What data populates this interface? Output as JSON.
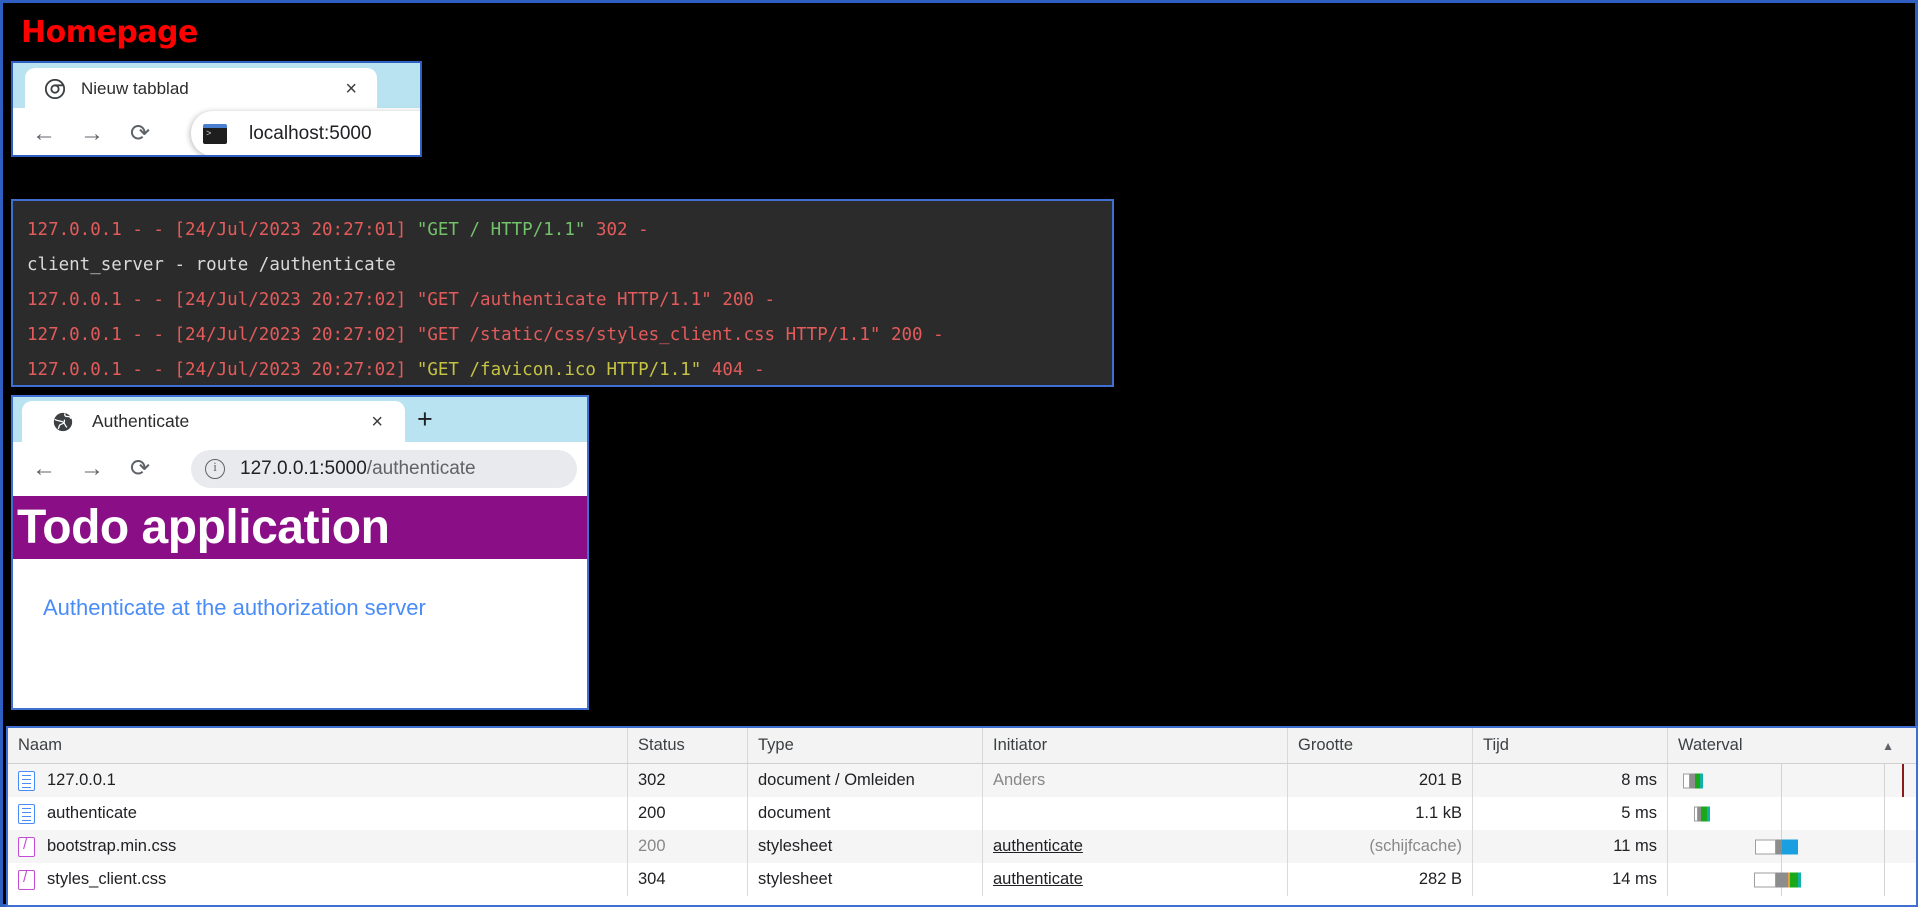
{
  "page": {
    "title": "Homepage",
    "background": "#000000",
    "border_color": "#2f5fc0",
    "title_color": "#ff0000"
  },
  "chrome_top": {
    "tab": {
      "title": "Nieuw tabblad",
      "close": "×",
      "favicon": "chrome-logo-icon"
    },
    "nav": {
      "back": "←",
      "forward": "→",
      "reload": "⟳"
    },
    "omnibox": {
      "url": "localhost:5000",
      "icon": "terminal-icon"
    }
  },
  "terminal": {
    "background": "#2b2b2b",
    "lines": [
      {
        "parts": [
          {
            "text": "127.0.0.1 - - [24/Jul/2023 20:27:01] ",
            "color": "red"
          },
          {
            "text": "\"GET / HTTP/1.1\" ",
            "color": "green"
          },
          {
            "text": "302 -",
            "color": "red"
          }
        ]
      },
      {
        "parts": [
          {
            "text": "client_server - route /authenticate",
            "color": "white"
          }
        ]
      },
      {
        "parts": [
          {
            "text": "127.0.0.1 - - [24/Jul/2023 20:27:02] \"GET /authenticate HTTP/1.1\" 200 -",
            "color": "red"
          }
        ]
      },
      {
        "parts": [
          {
            "text": "127.0.0.1 - - [24/Jul/2023 20:27:02] \"GET /static/css/styles_client.css HTTP/1.1\" 200 -",
            "color": "red"
          }
        ]
      },
      {
        "parts": [
          {
            "text": "127.0.0.1 - - [24/Jul/2023 20:27:02] ",
            "color": "red"
          },
          {
            "text": "\"GET /favicon.ico HTTP/1.1\" ",
            "color": "olive"
          },
          {
            "text": "404 -",
            "color": "red"
          }
        ]
      }
    ]
  },
  "chrome_auth": {
    "tab": {
      "title": "Authenticate",
      "close": "×",
      "favicon": "globe-icon"
    },
    "new_tab_button": "+",
    "nav": {
      "back": "←",
      "forward": "→",
      "reload": "⟳"
    },
    "omnibox": {
      "icon": "info-circle-icon",
      "host": "127.0.0.1:5000",
      "path": "/authenticate"
    },
    "banner": {
      "text": "Todo application",
      "color": "#8a0f87"
    },
    "link": {
      "text": "Authenticate at the authorization server",
      "color": "#4a8cf7"
    }
  },
  "devtools": {
    "columns": [
      "Naam",
      "Status",
      "Type",
      "Initiator",
      "Grootte",
      "Tijd",
      "Waterval"
    ],
    "sort_indicator": "▲",
    "rows": [
      {
        "icon": "document-icon",
        "name": "127.0.0.1",
        "status": "302",
        "type": "document / Omleiden",
        "initiator": "Anders",
        "initiator_link": false,
        "initiator_dim": true,
        "size": "201 B",
        "size_dim": false,
        "time": "8 ms",
        "status_dim": false
      },
      {
        "icon": "document-icon",
        "name": "authenticate",
        "status": "200",
        "type": "document",
        "initiator": "",
        "initiator_link": false,
        "initiator_dim": false,
        "size": "1.1 kB",
        "size_dim": false,
        "time": "5 ms",
        "status_dim": false
      },
      {
        "icon": "stylesheet-icon",
        "name": "bootstrap.min.css",
        "status": "200",
        "type": "stylesheet",
        "initiator": "authenticate",
        "initiator_link": true,
        "initiator_dim": false,
        "size": "(schijfcache)",
        "size_dim": true,
        "time": "11 ms",
        "status_dim": true
      },
      {
        "icon": "stylesheet-icon",
        "name": "styles_client.css",
        "status": "304",
        "type": "stylesheet",
        "initiator": "authenticate",
        "initiator_link": true,
        "initiator_dim": false,
        "size": "282 B",
        "size_dim": false,
        "time": "14 ms",
        "status_dim": false
      }
    ]
  }
}
